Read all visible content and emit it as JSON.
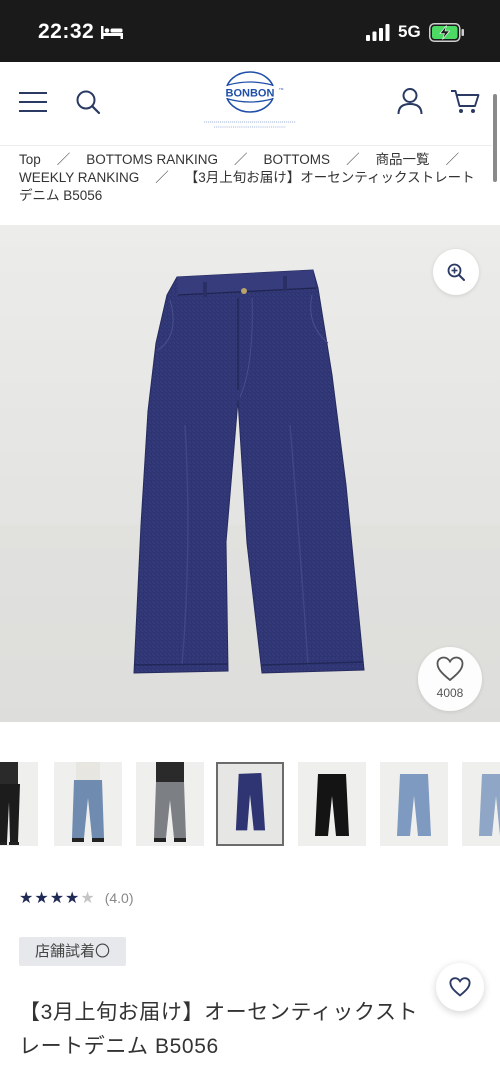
{
  "status_bar": {
    "time": "22:32",
    "network": "5G",
    "icons": [
      "bed-icon",
      "signal-icon",
      "battery-charging-icon"
    ]
  },
  "header": {
    "logo_text": "BONBON",
    "icons": [
      "menu-icon",
      "search-icon",
      "account-icon",
      "cart-icon"
    ]
  },
  "breadcrumb": {
    "items": [
      "Top",
      "BOTTOMS RANKING",
      "BOTTOMS",
      "商品一覧",
      "WEEKLY RANKING",
      "【3月上旬お届け】オーセンティックストレートデニム B5056"
    ],
    "separator": "／"
  },
  "gallery": {
    "favorite_count": "4008",
    "selected_index": 3,
    "thumbnails": [
      "black-pants-model",
      "light-denim-model",
      "grey-pants-model",
      "indigo-denim-flat",
      "black-denim-flat",
      "light-denim-flat",
      "light-denim-flat-2"
    ]
  },
  "rating": {
    "stars_filled": 4,
    "stars_total": 5,
    "value": "(4.0)"
  },
  "badge": "店舗試着〇",
  "product": {
    "title_line1": "【3月上旬お届け】オーセンティックスト",
    "title_line2": "レートデニム B5056"
  },
  "colors": {
    "status_bar_bg": "#1a1a1a",
    "star": "#1f2a55",
    "logo": "#1f4fa8",
    "denim": "#2f3572"
  }
}
